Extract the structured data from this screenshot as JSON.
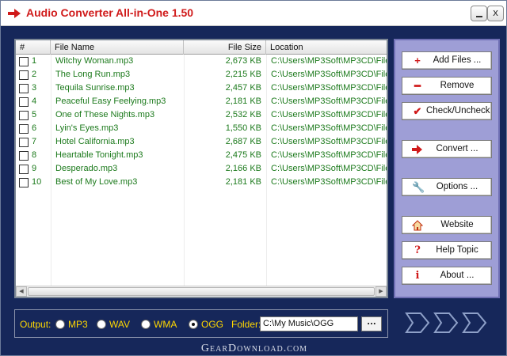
{
  "window": {
    "title": "Audio Converter All-in-One 1.50",
    "minimize_icon": "minimize-icon",
    "close_label": "x"
  },
  "table": {
    "headers": [
      "#",
      "File Name",
      "File Size",
      "Location"
    ],
    "rows": [
      {
        "num": "1",
        "name": "Witchy Woman.mp3",
        "size": "2,673 KB",
        "location": "C:\\Users\\MP3Soft\\MP3CD\\File"
      },
      {
        "num": "2",
        "name": "The Long Run.mp3",
        "size": "2,215 KB",
        "location": "C:\\Users\\MP3Soft\\MP3CD\\File"
      },
      {
        "num": "3",
        "name": "Tequila Sunrise.mp3",
        "size": "2,457 KB",
        "location": "C:\\Users\\MP3Soft\\MP3CD\\File"
      },
      {
        "num": "4",
        "name": "Peaceful Easy Feelying.mp3",
        "size": "2,181 KB",
        "location": "C:\\Users\\MP3Soft\\MP3CD\\File"
      },
      {
        "num": "5",
        "name": "One of These Nights.mp3",
        "size": "2,532 KB",
        "location": "C:\\Users\\MP3Soft\\MP3CD\\File"
      },
      {
        "num": "6",
        "name": "Lyin's Eyes.mp3",
        "size": "1,550 KB",
        "location": "C:\\Users\\MP3Soft\\MP3CD\\File"
      },
      {
        "num": "7",
        "name": "Hotel California.mp3",
        "size": "2,687 KB",
        "location": "C:\\Users\\MP3Soft\\MP3CD\\File"
      },
      {
        "num": "8",
        "name": "Heartable Tonight.mp3",
        "size": "2,475 KB",
        "location": "C:\\Users\\MP3Soft\\MP3CD\\File"
      },
      {
        "num": "9",
        "name": "Desperado.mp3",
        "size": "2,166 KB",
        "location": "C:\\Users\\MP3Soft\\MP3CD\\File"
      },
      {
        "num": "10",
        "name": "Best of My Love.mp3",
        "size": "2,181 KB",
        "location": "C:\\Users\\MP3Soft\\MP3CD\\File"
      }
    ]
  },
  "buttons": {
    "add_files": "Add Files ...",
    "remove": "Remove",
    "check_uncheck": "Check/Uncheck",
    "convert": "Convert ...",
    "options": "Options ...",
    "website": "Website",
    "help_topic": "Help Topic",
    "about": "About ..."
  },
  "output": {
    "label": "Output:",
    "formats": [
      "MP3",
      "WAV",
      "WMA",
      "OGG"
    ],
    "selected": "OGG",
    "folder_label": "Folder:",
    "folder_value": "C:\\My Music\\OGG",
    "browse_label": "..."
  },
  "watermark": "GearDownload.com",
  "colors": {
    "title_text": "#d01a1a",
    "background": "#16275a",
    "side_panel": "#9e9ed6",
    "file_text": "#1c7a1c",
    "output_label": "#ffd800"
  }
}
